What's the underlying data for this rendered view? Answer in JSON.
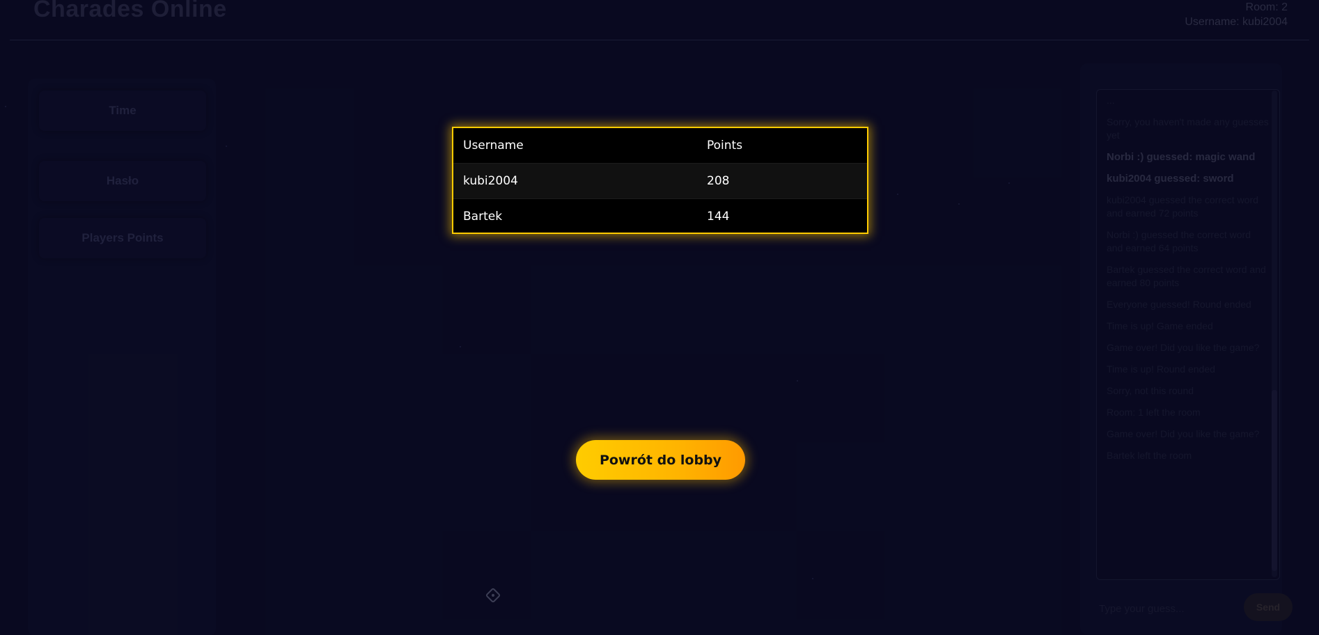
{
  "header": {
    "app_title": "Charades Online",
    "room_label": "Room: 2",
    "username_label": "Username: kubi2004"
  },
  "left_panel": {
    "cards": [
      "Time",
      "Hasło",
      "Players Points"
    ]
  },
  "chat": {
    "messages": [
      {
        "text": "...",
        "bold": false
      },
      {
        "text": "Sorry, you haven't made any guesses yet",
        "bold": false
      },
      {
        "text": "Norbi :) guessed: magic wand",
        "bold": true
      },
      {
        "text": "kubi2004 guessed: sword",
        "bold": true
      },
      {
        "text": "kubi2004 guessed the correct word and earned 72 points",
        "bold": false
      },
      {
        "text": "Norbi :) guessed the correct word and earned 64 points",
        "bold": false
      },
      {
        "text": "Bartek guessed the correct word and earned 80 points",
        "bold": false
      },
      {
        "text": "Everyone guessed! Round ended",
        "bold": false
      },
      {
        "text": "Time is up! Game ended",
        "bold": false
      },
      {
        "text": "Game over! Did you like the game?",
        "bold": false
      },
      {
        "text": "Time is up! Round ended",
        "bold": false
      },
      {
        "text": "Sorry, not this round",
        "bold": false
      },
      {
        "text": "Room: 1 left the room",
        "bold": false
      },
      {
        "text": "Game over! Did you like the game?",
        "bold": false
      },
      {
        "text": "Bartek left the room",
        "bold": false
      }
    ],
    "input_placeholder": "Type your guess...",
    "send_label": "Send"
  },
  "scoreboard": {
    "headers": {
      "username": "Username",
      "points": "Points"
    },
    "rows": [
      {
        "username": "kubi2004",
        "points": "208"
      },
      {
        "username": "Bartek",
        "points": "144"
      }
    ]
  },
  "lobby_button_label": "Powrót do lobby",
  "colors": {
    "background": "#0b0c24",
    "accent": "#ffcc00",
    "accent_end": "#ff9a00"
  },
  "icons": {
    "canvas_tool": "paint-bucket-icon"
  }
}
